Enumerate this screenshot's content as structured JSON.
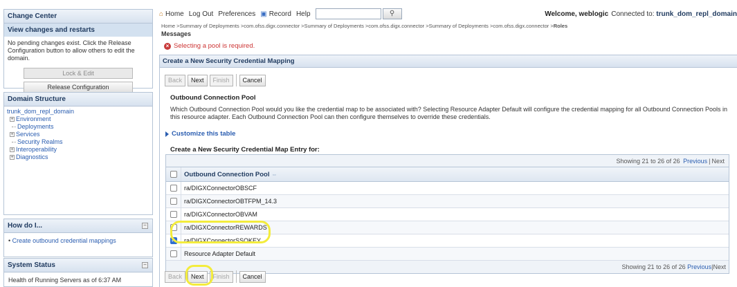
{
  "change_center": {
    "title": "Change Center",
    "view_changes": "View changes and restarts",
    "message": "No pending changes exist. Click the Release Configuration button to allow others to edit the domain.",
    "lock_edit": "Lock & Edit",
    "release_config": "Release Configuration"
  },
  "domain_structure": {
    "title": "Domain Structure",
    "root": "trunk_dom_repl_domain",
    "items": [
      {
        "label": "Environment",
        "expand": "+"
      },
      {
        "label": "Deployments",
        "expand": ""
      },
      {
        "label": "Services",
        "expand": "+"
      },
      {
        "label": "Security Realms",
        "expand": ""
      },
      {
        "label": "Interoperability",
        "expand": "+"
      },
      {
        "label": "Diagnostics",
        "expand": "+"
      }
    ]
  },
  "how_do_i": {
    "title": "How do I...",
    "link": "Create outbound credential mappings"
  },
  "system_status": {
    "title": "System Status",
    "health": "Health of Running Servers as of  6:37 AM"
  },
  "topbar": {
    "home": "Home",
    "logout": "Log Out",
    "preferences": "Preferences",
    "record": "Record",
    "help": "Help",
    "search_value": "",
    "welcome": "Welcome, weblogic",
    "connected_label": "Connected to:",
    "connected_to": "trunk_dom_repl_domain"
  },
  "breadcrumb": {
    "path": "Home >Summary of Deployments >com.ofss.digx.connector >Summary of Deployments >com.ofss.digx.connector >Summary of Deployments >com.ofss.digx.connector >",
    "current": "Roles"
  },
  "messages": {
    "title": "Messages",
    "error": "Selecting a pool is required."
  },
  "content": {
    "title": "Create a New Security Credential Mapping",
    "buttons": {
      "back": "Back",
      "next": "Next",
      "finish": "Finish",
      "cancel": "Cancel"
    },
    "section_title": "Outbound Connection Pool",
    "description": "Which Outbound Connection Pool would you like the credential map to be associated with? Selecting Resource Adapter Default will configure the credential mapping for all Outbound Connection Pools in this resource adapter. Each Outbound Connection Pool can then configure themselves to override these credentials.",
    "customize": "Customize this table",
    "table_title": "Create a New Security Credential Map Entry for:",
    "paging": {
      "showing": "Showing 21 to 26 of 26",
      "previous": "Previous",
      "next": "Next"
    },
    "column_header": "Outbound Connection Pool",
    "rows": [
      {
        "label": "ra/DIGXConnectorOBSCF",
        "checked": false
      },
      {
        "label": "ra/DIGXConnectorOBTFPM_14.3",
        "checked": false
      },
      {
        "label": "ra/DIGXConnectorOBVAM",
        "checked": false
      },
      {
        "label": "ra/DIGXConnectorREWARDS",
        "checked": false
      },
      {
        "label": "ra/DIGXConnectorSSOKEY",
        "checked": true
      },
      {
        "label": "Resource Adapter Default",
        "checked": false
      }
    ]
  },
  "colors": {
    "highlight": "#f3ec3c",
    "link": "#2a5db0",
    "header": "#1f3a5f",
    "error": "#c33"
  }
}
